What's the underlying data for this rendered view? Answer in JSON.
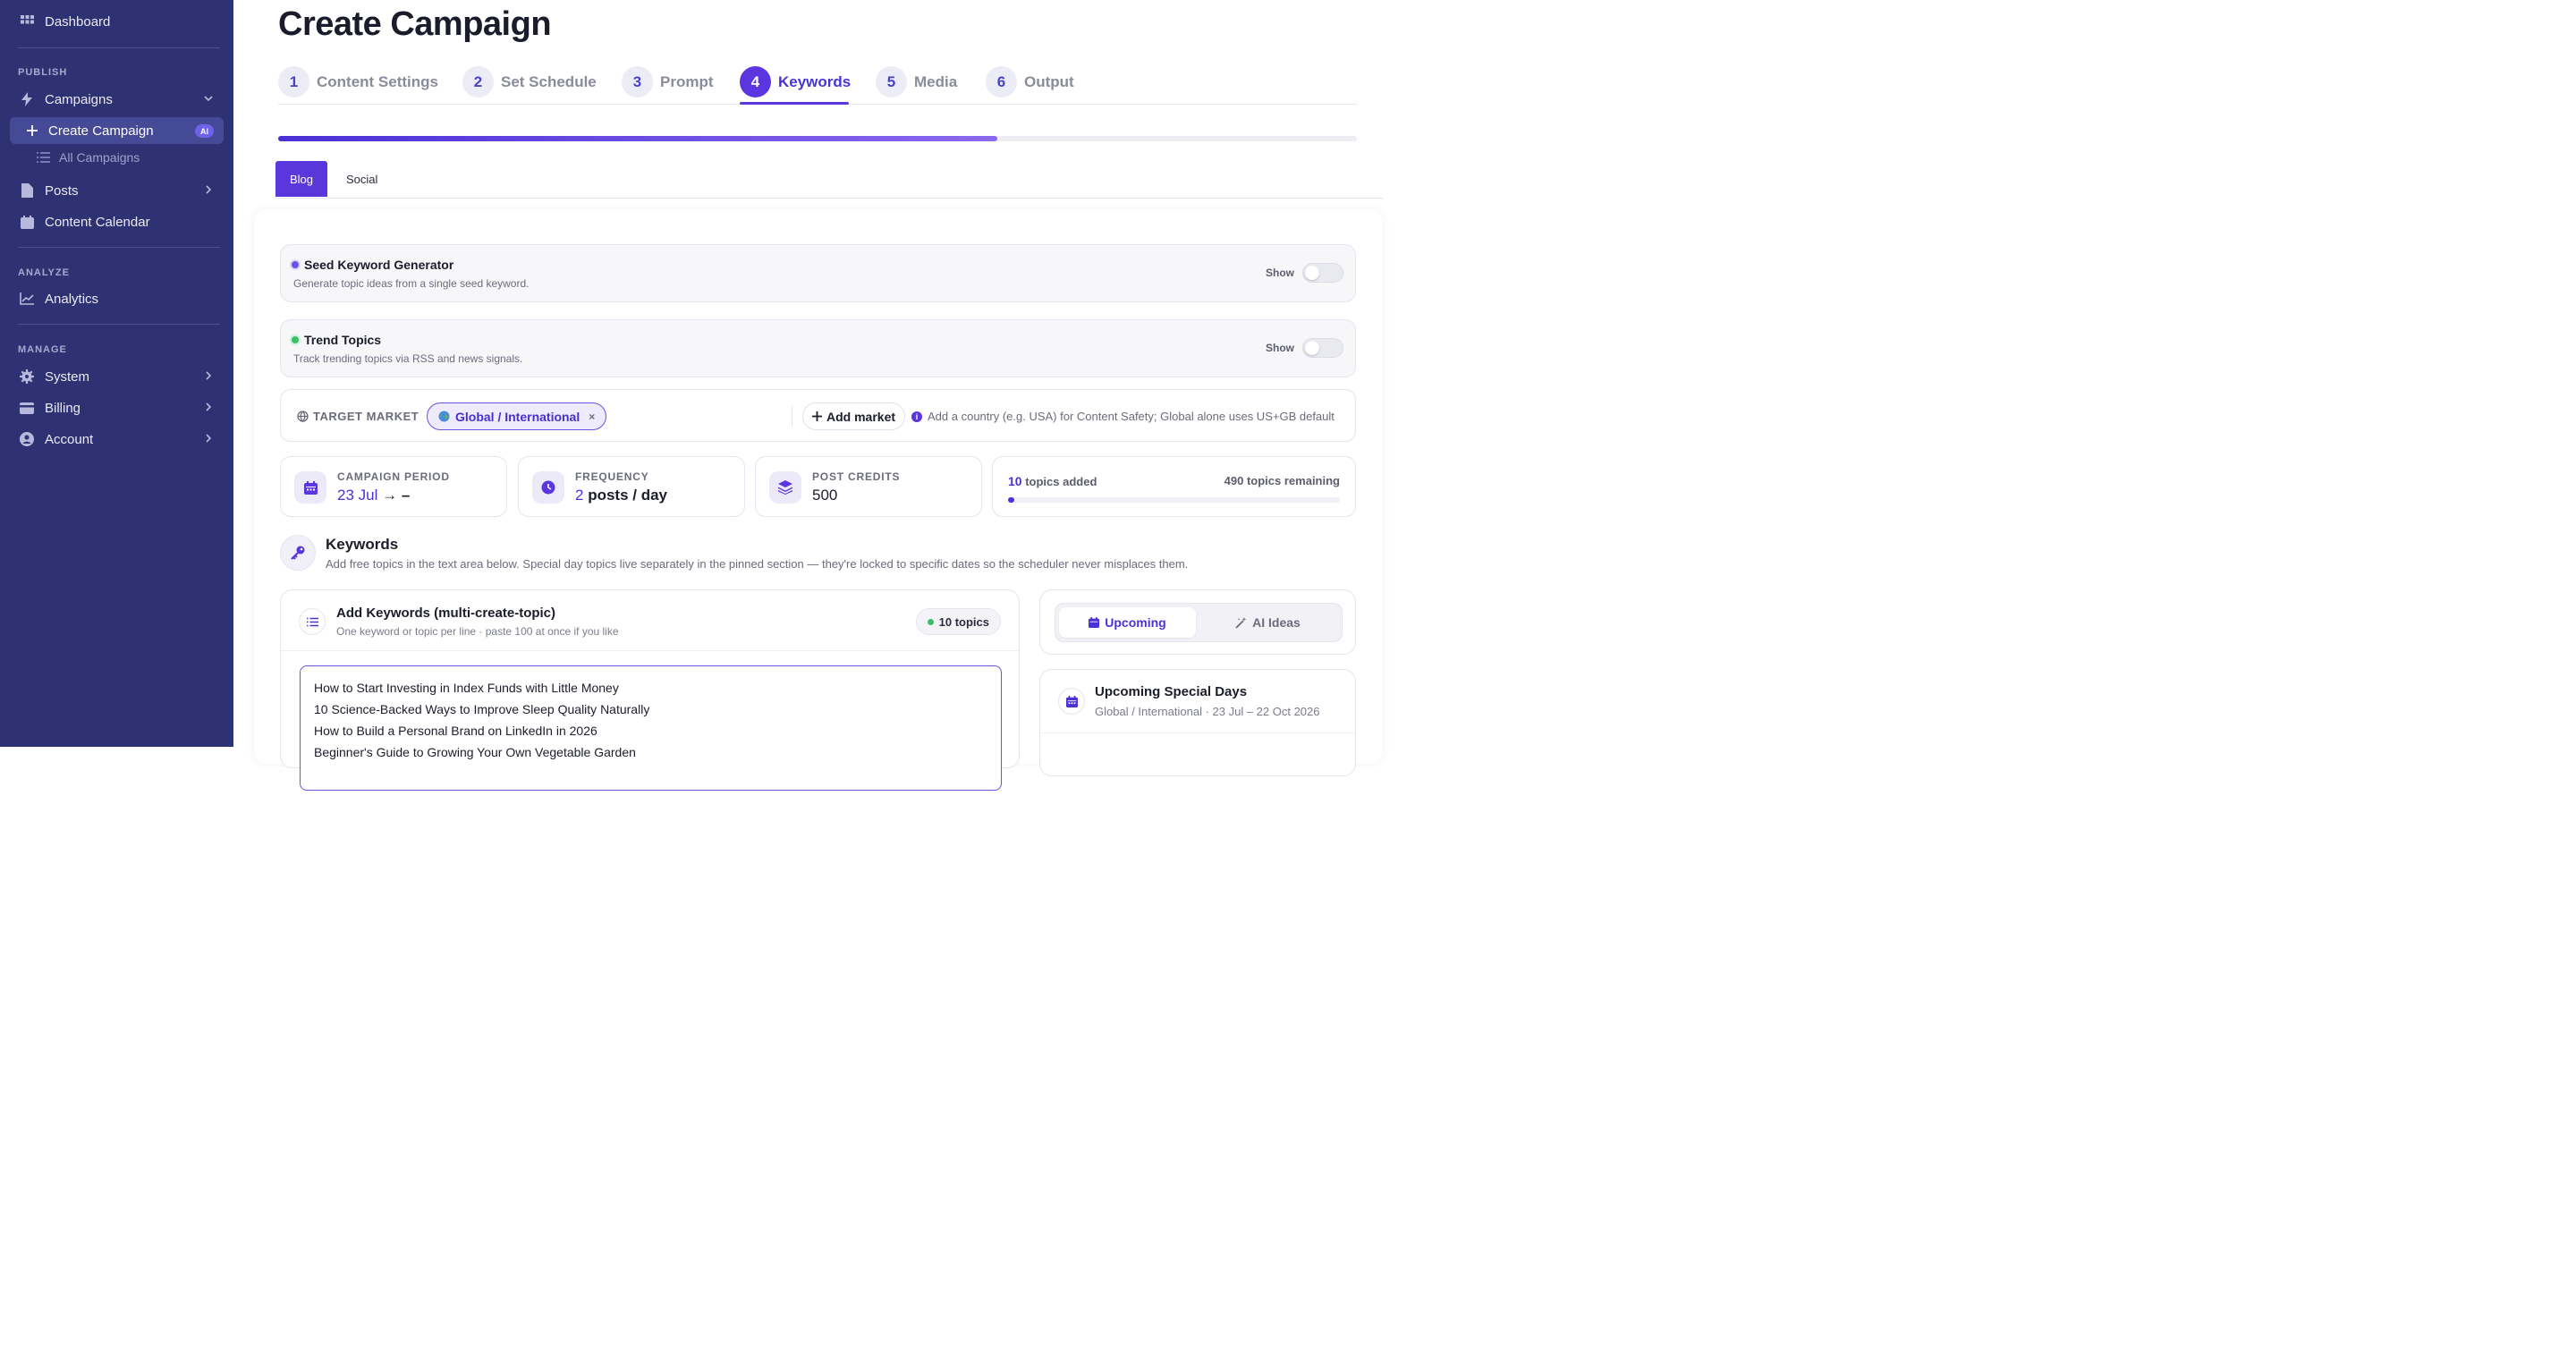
{
  "sidebar": {
    "dashboard": "Dashboard",
    "publish_section": "PUBLISH",
    "campaigns": "Campaigns",
    "create_campaign": "Create Campaign",
    "ai_badge": "AI",
    "all_campaigns": "All Campaigns",
    "posts": "Posts",
    "content_calendar": "Content Calendar",
    "analyze_section": "ANALYZE",
    "analytics": "Analytics",
    "manage_section": "MANAGE",
    "system": "System",
    "billing": "Billing",
    "account": "Account"
  },
  "header": {
    "title": "Create Campaign"
  },
  "steps": [
    {
      "num": "1",
      "label": "Content Settings"
    },
    {
      "num": "2",
      "label": "Set Schedule"
    },
    {
      "num": "3",
      "label": "Prompt"
    },
    {
      "num": "4",
      "label": "Keywords"
    },
    {
      "num": "5",
      "label": "Media"
    },
    {
      "num": "6",
      "label": "Output"
    }
  ],
  "active_step": 4,
  "wizard_progress": 0.667,
  "tabs": {
    "blog": "Blog",
    "social": "Social",
    "active": "Blog"
  },
  "seed_generator": {
    "title": "Seed Keyword Generator",
    "desc": "Generate topic ideas from a single seed keyword.",
    "show_label": "Show",
    "enabled": false
  },
  "trend_topics": {
    "title": "Trend Topics",
    "desc": "Track trending topics via RSS and news signals.",
    "show_label": "Show",
    "enabled": false
  },
  "target_market": {
    "label": "TARGET MARKET",
    "chip": "Global / International",
    "chip_remove": "×",
    "add_button": "Add market",
    "hint": "Add a country (e.g. USA) for Content Safety; Global alone uses US+GB default"
  },
  "stats": {
    "period_label": "CAMPAIGN PERIOD",
    "period_start": "23 Jul",
    "period_sep": "→ –",
    "frequency_label": "FREQUENCY",
    "frequency_num": "2",
    "frequency_unit": "posts / day",
    "credits_label": "POST CREDITS",
    "credits_value": "500",
    "topics_added_num": "10",
    "topics_added_text": "topics added",
    "topics_remaining": "490 topics remaining",
    "topics_fraction": 0.02
  },
  "keywords": {
    "title": "Keywords",
    "desc": "Add free topics in the text area below. Special day topics live separately in the pinned section — they're locked to specific dates so the scheduler never misplaces them.",
    "add_title": "Add Keywords (multi-create-topic)",
    "add_sub": "One keyword or topic per line · paste 100 at once if you like",
    "count_badge": "10 topics",
    "lines": [
      "How to Start Investing in Index Funds with Little Money",
      "10 Science-Backed Ways to Improve Sleep Quality Naturally",
      "How to Build a Personal Brand on LinkedIn in 2026",
      "Beginner's Guide to Growing Your Own Vegetable Garden"
    ]
  },
  "side_panel": {
    "upcoming": "Upcoming",
    "ai_ideas": "AI Ideas",
    "special_title": "Upcoming Special Days",
    "special_sub": "Global / International · 23 Jul – 22 Oct 2026"
  },
  "colors": {
    "sidebar": "#2f3272",
    "accent": "#5b35e0",
    "green_dot": "#3bbf6a"
  }
}
